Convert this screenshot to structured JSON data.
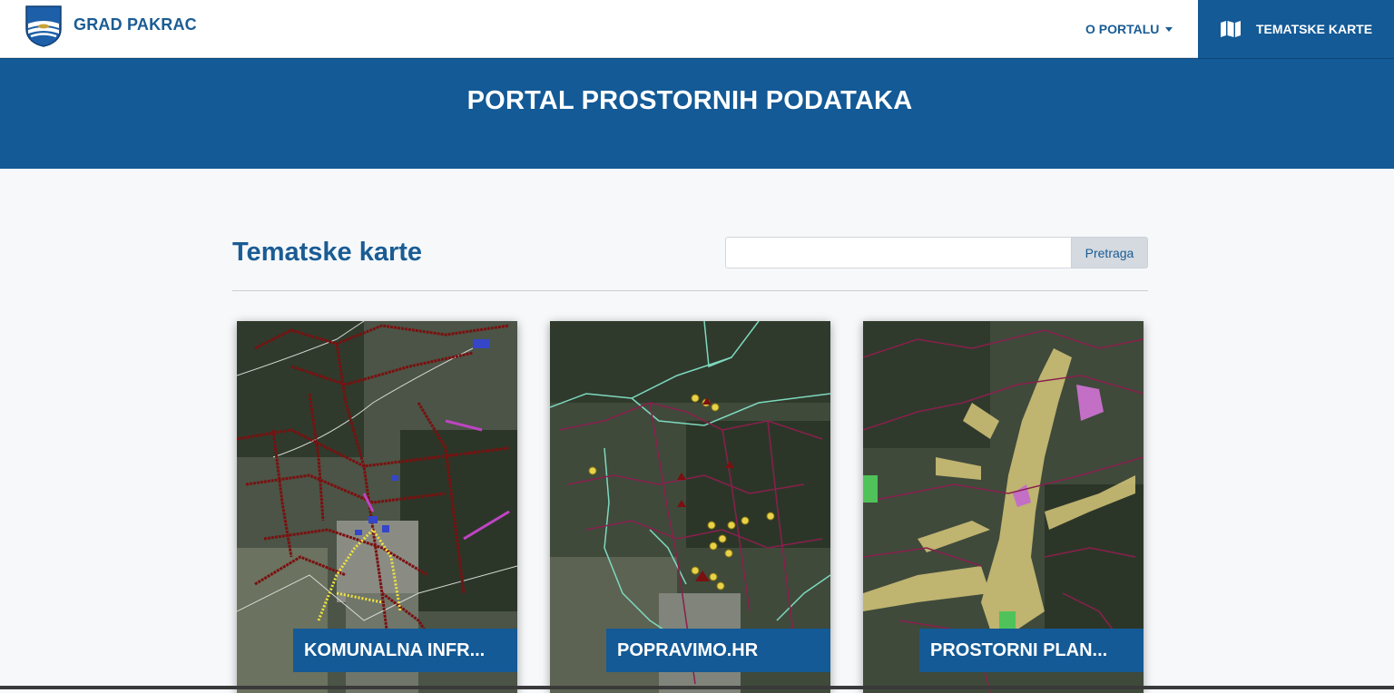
{
  "header": {
    "brand_name": "GRAD PAKRAC",
    "nav": {
      "about_label": "O PORTALU",
      "maps_label": "TEMATSKE KARTE"
    },
    "icons": [
      "coat-of-arms-logo",
      "map-icon",
      "caret-down-icon"
    ]
  },
  "hero": {
    "title": "PORTAL PROSTORNIH PODATAKA"
  },
  "main": {
    "section_title": "Tematske karte",
    "search": {
      "placeholder": "",
      "value": "",
      "button_label": "Pretraga"
    },
    "cards": [
      {
        "label": "KOMUNALNA INFR..."
      },
      {
        "label": "POPRAVIMO.HR"
      },
      {
        "label": "PROSTORNI PLAN..."
      }
    ]
  },
  "colors": {
    "brand_blue": "#135a96",
    "text_blue": "#1a5c94",
    "page_background": "#f6f8fa"
  }
}
